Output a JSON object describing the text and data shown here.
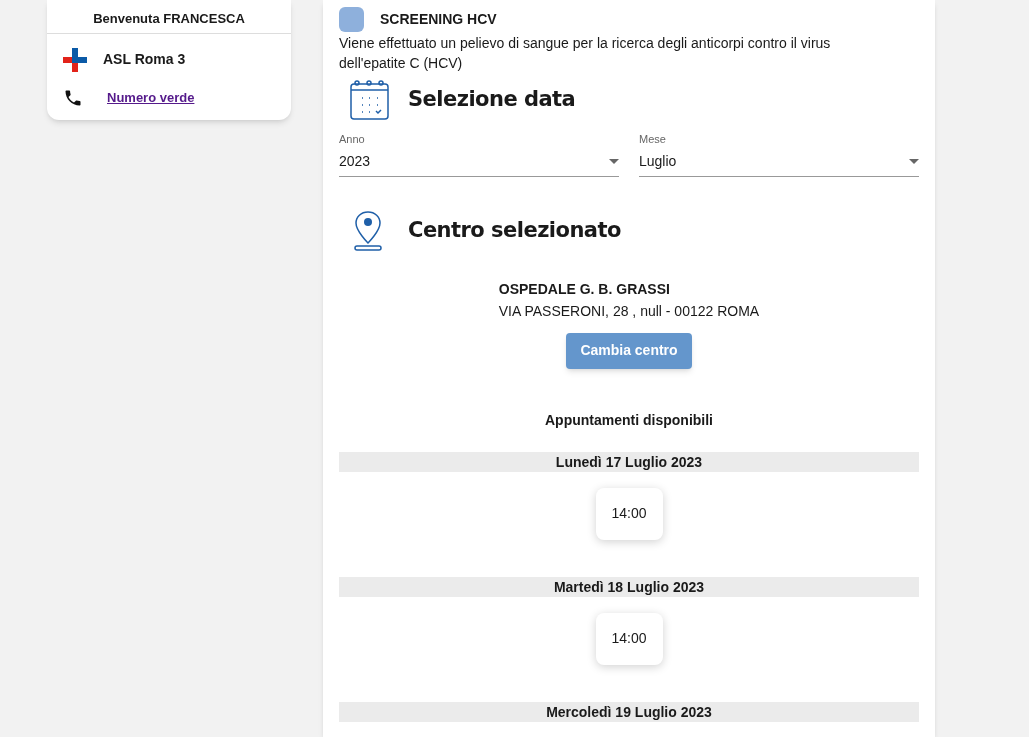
{
  "user_card": {
    "greeting": "Benvenuta FRANCESCA",
    "asl": "ASL Roma 3",
    "phone_link": "Numero verde"
  },
  "service": {
    "title": "SCREENING HCV",
    "description": "Viene effettuato un pelievo di sangue per la ricerca degli anticorpi contro il virus dell'epatite C (HCV)"
  },
  "date_section": {
    "title": "Selezione data",
    "fields": [
      {
        "label": "Anno",
        "value": "2023"
      },
      {
        "label": "Mese",
        "value": "Luglio"
      }
    ]
  },
  "center_section": {
    "title": "Centro selezionato",
    "name": "OSPEDALE G. B. GRASSI",
    "address": "VIA PASSERONI, 28 , null - 00122 ROMA",
    "button": "Cambia centro"
  },
  "appointments": {
    "title": "Appuntamenti disponibili",
    "days": [
      {
        "date": "Lunedì 17 Luglio 2023",
        "slots": [
          "14:00"
        ]
      },
      {
        "date": "Martedì 18 Luglio 2023",
        "slots": [
          "14:00"
        ]
      },
      {
        "date": "Mercoledì 19 Luglio 2023"
      }
    ]
  }
}
